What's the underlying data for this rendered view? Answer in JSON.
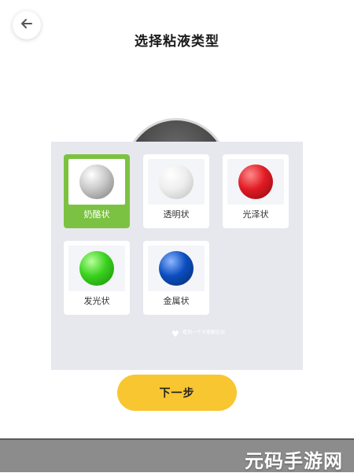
{
  "header": {
    "back_icon": "arrow-left-icon",
    "title": "选择粘液类型"
  },
  "slime_types": [
    {
      "label": "奶酪状",
      "color": "#c8c8c8",
      "selected": true
    },
    {
      "label": "透明状",
      "color": "#e6e6e6",
      "selected": false
    },
    {
      "label": "光泽状",
      "color": "#e01b24",
      "selected": false
    },
    {
      "label": "发光状",
      "color": "#39d11e",
      "selected": false
    },
    {
      "label": "金属状",
      "color": "#0b4ec0",
      "selected": false
    }
  ],
  "watermark": {
    "line1": "看到一个大家都在玩",
    "line2": "",
    "icon": "heart-icon"
  },
  "next_button": {
    "label": "下一步"
  },
  "footer": {
    "brand": "元码手游网"
  },
  "colors": {
    "accent_selected": "#7cc242",
    "button_yellow": "#f8c630",
    "panel_bg": "#e7e8ee"
  }
}
